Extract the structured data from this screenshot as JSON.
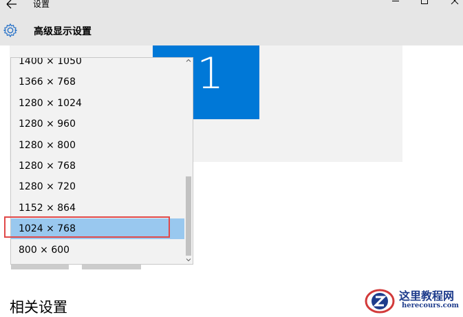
{
  "window": {
    "title": "设置",
    "back_icon": "arrow-left-icon",
    "controls": [
      "minimize-icon",
      "maximize-icon",
      "close-icon"
    ]
  },
  "header": {
    "icon": "gear-icon",
    "title": "高级显示设置"
  },
  "preview": {
    "monitor_number": "1",
    "monitor_color": "#0078d7"
  },
  "resolution_dropdown": {
    "options": [
      "1400 × 1050",
      "1366 × 768",
      "1280 × 1024",
      "1280 × 960",
      "1280 × 800",
      "1280 × 768",
      "1280 × 720",
      "1152 × 864",
      "1024 × 768",
      "800 × 600"
    ],
    "selected": "1024 × 768",
    "selected_color": "#99c8ef",
    "highlight_color": "#e04848"
  },
  "related": {
    "heading": "相关设置"
  },
  "watermark": {
    "title": "这里教程网",
    "subtitle": "herecours.com",
    "logo_letter": "Z"
  }
}
